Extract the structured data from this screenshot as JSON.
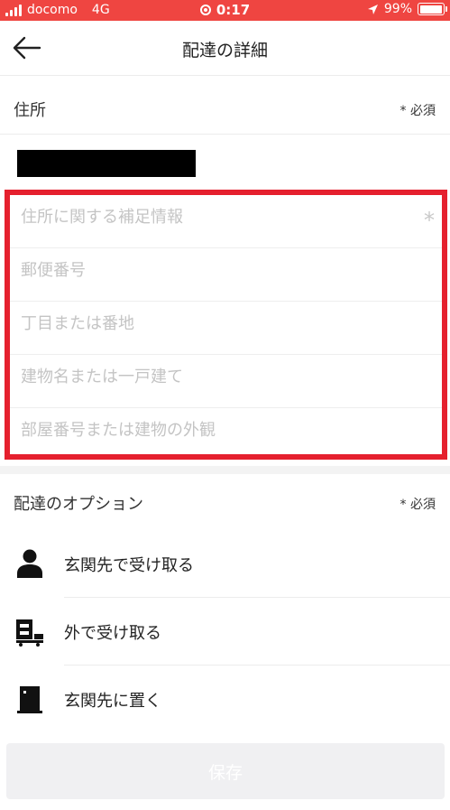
{
  "status_bar": {
    "carrier": "docomo",
    "network": "4G",
    "time": "0:17",
    "battery": "99%",
    "battery_level": 0.99,
    "color": "#ef4541"
  },
  "nav": {
    "title": "配達の詳細",
    "back_icon": "arrow-left-icon"
  },
  "address_section": {
    "label": "住所",
    "required": "* 必須",
    "fields": [
      {
        "placeholder": "住所に関する補足情報",
        "value": "",
        "required_mark": "*"
      },
      {
        "placeholder": "郵便番号",
        "value": ""
      },
      {
        "placeholder": "丁目または番地",
        "value": ""
      },
      {
        "placeholder": "建物名または一戸建て",
        "value": ""
      },
      {
        "placeholder": "部屋番号または建物の外観",
        "value": ""
      }
    ],
    "highlight_color": "#e5202e"
  },
  "options_section": {
    "label": "配達のオプション",
    "required": "* 必須",
    "options": [
      {
        "label": "玄関先で受け取る",
        "icon": "person-icon"
      },
      {
        "label": "外で受け取る",
        "icon": "delivery-cart-icon"
      },
      {
        "label": "玄関先に置く",
        "icon": "door-icon"
      }
    ]
  },
  "save_button": {
    "label": "保存"
  }
}
